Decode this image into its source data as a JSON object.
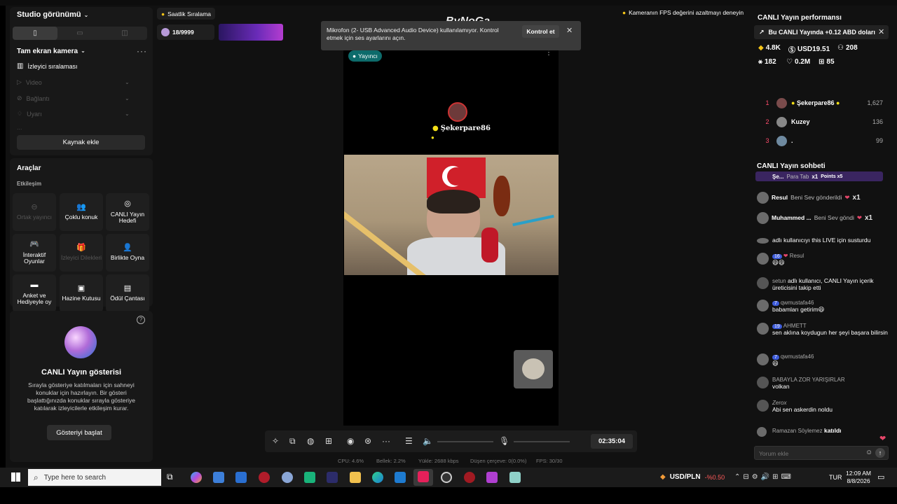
{
  "left": {
    "studio_title": "Studio görünümü",
    "scene_title": "Tam ekran kamera",
    "sources": [
      "İzleyici sıralaması",
      "Video",
      "Bağlantı",
      "Uyarı",
      "..."
    ],
    "add_source": "Kaynak ekle",
    "tools_title": "Araçlar",
    "tools_section": "Etkileşim",
    "tools": [
      {
        "label": "Ortak yayıncı",
        "enabled": false
      },
      {
        "label": "Çoklu konuk",
        "enabled": true
      },
      {
        "label": "CANLI Yayın Hedefi",
        "enabled": true
      },
      {
        "label": "İnteraktif Oyunlar",
        "enabled": true
      },
      {
        "label": "İzleyici Dilekleri",
        "enabled": false
      },
      {
        "label": "Birlikte Oyna",
        "enabled": true
      },
      {
        "label": "Anket ve Hediyeyle oy",
        "enabled": true
      },
      {
        "label": "Hazine Kutusu",
        "enabled": true
      },
      {
        "label": "Ödül Çantası",
        "enabled": true
      }
    ],
    "show_title": "CANLI Yayın gösterisi",
    "show_desc": "Sırayla gösteriye katılmaları için sahneyi konuklar için hazırlayın. Bir gösteri başlattığınızda konuklar sırayla gösteriye katılarak izleyicilerle etkileşim kurar.",
    "show_button": "Gösteriyi başlat"
  },
  "center": {
    "ranking_pill": "Saatlik Sıralama",
    "viewer_count": "18/9999",
    "hint": "Kameranın FPS değerini azaltmayı deneyin",
    "watermark": "ByNoGa",
    "toast_text": "Mikrofon (2- USB Advanced Audio Device) kullanılamıyor. Kontrol etmek için ses ayarlarını açın.",
    "toast_button": "Kontrol et",
    "host_badge": "Yayıncı",
    "overlay_name": "Şekerpare86",
    "timer": "02:35:04",
    "stats": {
      "cpu": "CPU: 4.6%",
      "memory": "Bellek: 2.2%",
      "upload": "Yükle: 2688 kbps",
      "dropped": "Düşen çerçeve: 0(0.0%)",
      "fps": "FPS: 30/30"
    }
  },
  "right": {
    "perf_title": "CANLI Yayın performansı",
    "perf_banner": "Bu CANLI Yayında +0.12 ABD doları",
    "stats": [
      "4.8K",
      "USD19.51",
      "208",
      "182",
      "0.2M",
      "85"
    ],
    "ranking": [
      {
        "rank": "1",
        "name": "Şekerpare86",
        "value": "1,627"
      },
      {
        "rank": "2",
        "name": "Kuzey",
        "value": "136"
      },
      {
        "rank": "3",
        "name": ".",
        "value": "99"
      }
    ],
    "chat_title": "CANLI Yayın sohbeti",
    "chat_top": {
      "name": "Şe...",
      "sub": "Para Tab",
      "mult": "x1",
      "points": "Points x5"
    },
    "gifts": [
      {
        "name": "Resul",
        "text": "Beni Sev gönderildi",
        "mult": "x1"
      },
      {
        "name": "Muhammed ...",
        "text": "Beni Sev göndi",
        "mult": "x1"
      }
    ],
    "messages": [
      {
        "user": "",
        "badge": "",
        "text": "adlı kullanıcıyı this LIVE için susturdu"
      },
      {
        "user": "Resul",
        "badge": "16",
        "text": "😆😆"
      },
      {
        "user": "setun",
        "badge": "",
        "text": "adlı kullanıcı, CANLI Yayın içerik üreticisini takip etti"
      },
      {
        "user": "qwmustafa46",
        "badge": "7",
        "text": "babamları getirim😆"
      },
      {
        "user": "AHMETT",
        "badge": "19",
        "text": "sen aklına koydugun her şeyi başara bilirsin"
      },
      {
        "user": "qwmustafa46",
        "badge": "7",
        "text": "😆"
      },
      {
        "user": "BABAYLA ZOR YARIŞIRLAR",
        "badge": "",
        "text": "volkan"
      },
      {
        "user": "Zerox",
        "badge": "",
        "text": "Abi sen askerdin noldu"
      },
      {
        "user": "Ramazan Söylemez",
        "badge": "",
        "text": "katıldı"
      }
    ],
    "comment_placeholder": "Yorum ekle"
  },
  "taskbar": {
    "search_placeholder": "Type here to search",
    "currency": "USD/PLN",
    "change": "-%0.50",
    "lang": "TUR",
    "time": "12:09 AM",
    "date": "8/8/2026"
  }
}
